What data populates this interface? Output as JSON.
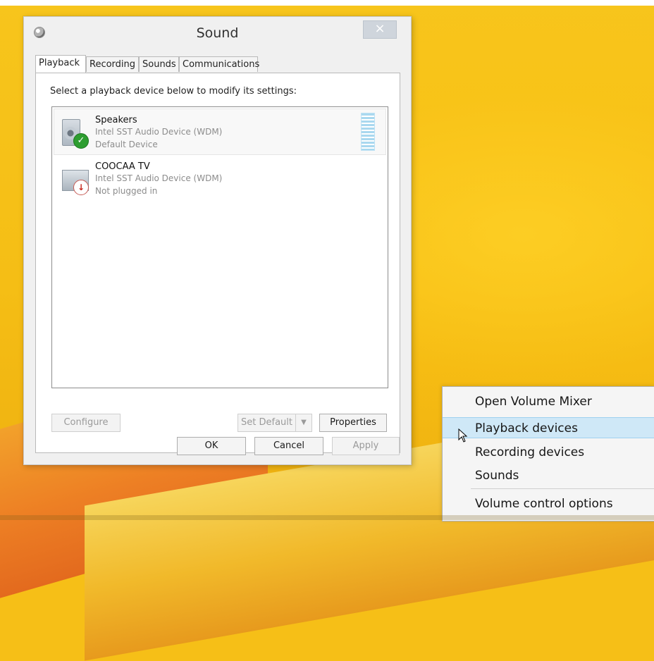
{
  "window": {
    "title": "Sound",
    "close_label": "×"
  },
  "tabs": [
    {
      "label": "Playback"
    },
    {
      "label": "Recording"
    },
    {
      "label": "Sounds"
    },
    {
      "label": "Communications"
    }
  ],
  "playback": {
    "instruction": "Select a playback device below to modify its settings:",
    "devices": [
      {
        "name": "Speakers",
        "description": "Intel SST Audio Device (WDM)",
        "status": "Default Device",
        "badge": "✓"
      },
      {
        "name": "COOCAA TV",
        "description": "Intel SST Audio Device (WDM)",
        "status": "Not plugged in",
        "badge": "↓"
      }
    ]
  },
  "buttons": {
    "configure": "Configure",
    "set_default": "Set Default",
    "set_default_arrow": "▼",
    "properties": "Properties",
    "ok": "OK",
    "cancel": "Cancel",
    "apply": "Apply"
  },
  "context_menu": {
    "items": [
      {
        "label": "Open Volume Mixer"
      },
      {
        "label": "Playback devices"
      },
      {
        "label": "Recording devices"
      },
      {
        "label": "Sounds"
      },
      {
        "label": "Volume control options"
      }
    ],
    "highlight_color": "#cfe8f7"
  },
  "colors": {
    "desktop": "#f6bf17",
    "accent": "#2d9d30"
  }
}
